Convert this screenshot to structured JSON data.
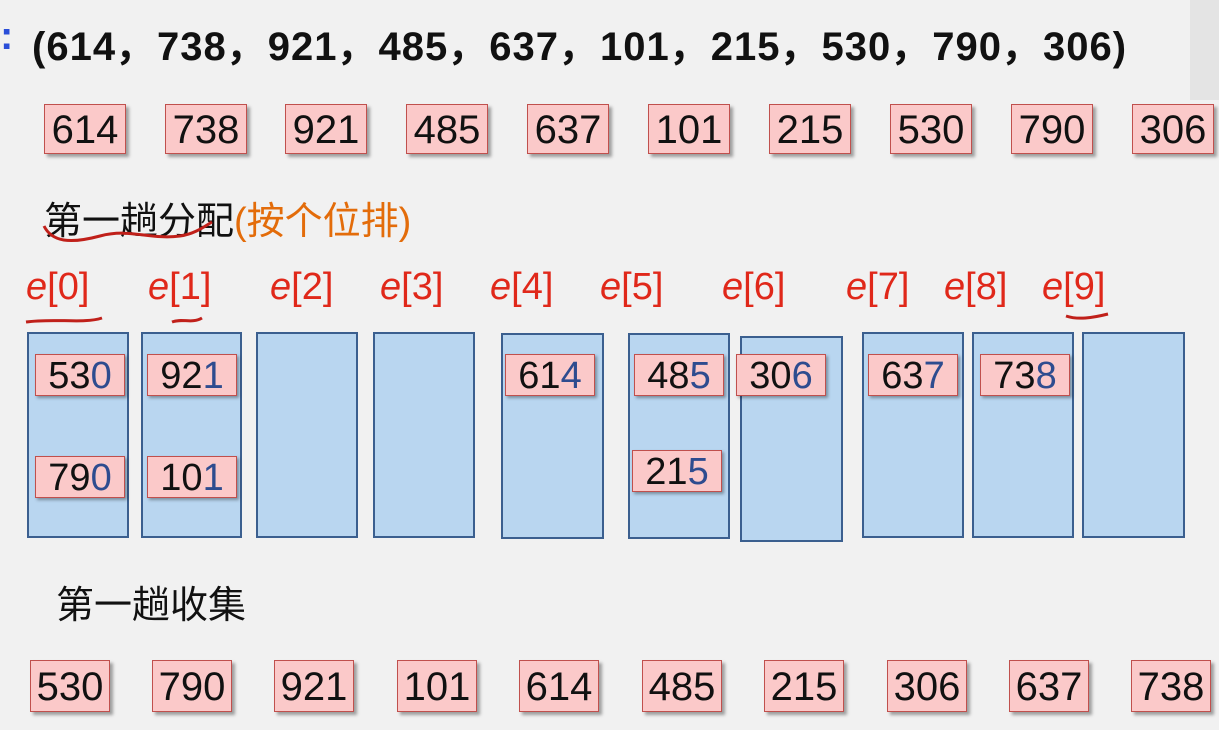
{
  "header": {
    "colon": ":",
    "sequence": "(614，738，921，485，637，101，215，530，790，306)"
  },
  "input_row": [
    "614",
    "738",
    "921",
    "485",
    "637",
    "101",
    "215",
    "530",
    "790",
    "306"
  ],
  "distribute": {
    "title": "第一趟分配",
    "note": "(按个位排)"
  },
  "buckets": [
    {
      "label_e": "e",
      "label_idx": "[0]",
      "items": [
        {
          "head": "53",
          "tail": "0"
        },
        {
          "head": "79",
          "tail": "0"
        }
      ]
    },
    {
      "label_e": "e",
      "label_idx": "[1]",
      "items": [
        {
          "head": "92",
          "tail": "1"
        },
        {
          "head": "10",
          "tail": "1"
        }
      ]
    },
    {
      "label_e": "e",
      "label_idx": "[2]",
      "items": []
    },
    {
      "label_e": "e",
      "label_idx": "[3]",
      "items": []
    },
    {
      "label_e": "e",
      "label_idx": "[4]",
      "items": [
        {
          "head": "61",
          "tail": "4"
        }
      ]
    },
    {
      "label_e": "e",
      "label_idx": "[5]",
      "items": [
        {
          "head": "48",
          "tail": "5"
        },
        {
          "head": "21",
          "tail": "5"
        }
      ]
    },
    {
      "label_e": "e",
      "label_idx": "[6]",
      "items": [
        {
          "head": "30",
          "tail": "6"
        }
      ]
    },
    {
      "label_e": "e",
      "label_idx": "[7]",
      "items": [
        {
          "head": "63",
          "tail": "7"
        }
      ]
    },
    {
      "label_e": "e",
      "label_idx": "[8]",
      "items": [
        {
          "head": "73",
          "tail": "8"
        }
      ]
    },
    {
      "label_e": "e",
      "label_idx": "[9]",
      "items": []
    }
  ],
  "collect": {
    "title": "第一趟收集"
  },
  "output_row": [
    "530",
    "790",
    "921",
    "101",
    "614",
    "485",
    "215",
    "306",
    "637",
    "738"
  ],
  "colors": {
    "chip_fill": "#fbc9c9",
    "chip_border": "#c0504d",
    "bucket_fill": "#b9d6f0",
    "bucket_border": "#3b5f8f",
    "label_red": "#e0281a",
    "note_orange": "#e36c0a",
    "digit_blue": "#2e4c8f"
  }
}
